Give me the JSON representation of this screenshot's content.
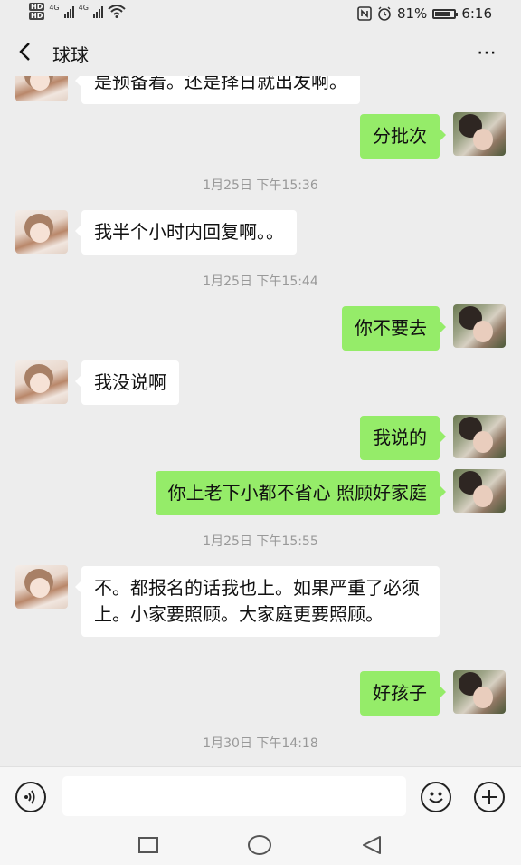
{
  "status_bar": {
    "hd_badges": [
      "HD",
      "HD"
    ],
    "network_1": "4G",
    "network_2": "4G",
    "battery_percent": "81%",
    "battery_level": 0.81,
    "time": "6:16"
  },
  "header": {
    "title": "球球",
    "more_label": "⋯"
  },
  "messages": [
    {
      "type": "message",
      "from": "her",
      "text": "是预备着。还是择日就出发啊。"
    },
    {
      "type": "message",
      "from": "me",
      "text": "分批次"
    },
    {
      "type": "timestamp",
      "text": "1月25日 下午15:36"
    },
    {
      "type": "message",
      "from": "her",
      "text": "我半个小时内回复啊。。"
    },
    {
      "type": "timestamp",
      "text": "1月25日 下午15:44"
    },
    {
      "type": "message",
      "from": "me",
      "text": "你不要去"
    },
    {
      "type": "message",
      "from": "her",
      "text": "我没说啊"
    },
    {
      "type": "message",
      "from": "me",
      "text": "我说的"
    },
    {
      "type": "message",
      "from": "me",
      "text": "你上老下小都不省心 照顾好家庭"
    },
    {
      "type": "timestamp",
      "text": "1月25日 下午15:55"
    },
    {
      "type": "message",
      "from": "her",
      "text": "不。都报名的话我也上。如果严重了必须上。小家要照顾。大家庭更要照顾。"
    },
    {
      "type": "message",
      "from": "me",
      "text": "好孩子"
    },
    {
      "type": "timestamp",
      "text": "1月30日 下午14:18"
    }
  ],
  "input_bar": {
    "message_value": "",
    "icons": [
      "voice-icon",
      "emoji-icon",
      "plus-icon"
    ]
  },
  "system_nav": {
    "icons": [
      "recent-apps-icon",
      "home-icon",
      "back-icon"
    ]
  },
  "colors": {
    "background": "#ededed",
    "outgoing_bubble": "#95ec69",
    "incoming_bubble": "#ffffff",
    "timestamp": "#999999"
  }
}
